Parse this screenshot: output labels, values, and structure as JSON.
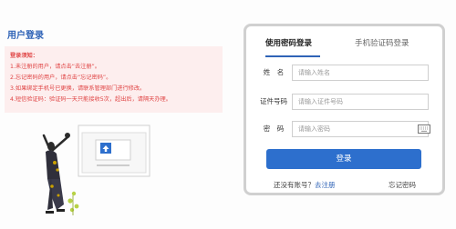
{
  "page": {
    "title": "用户登录"
  },
  "notice": {
    "title": "登录须知：",
    "lines": [
      "1.未注册的用户，请点击“去注册”。",
      "2.忘记密码的用户，请点击“忘记密码”。",
      "3.如果绑定手机号已更换，请联系管理部门进行修改。",
      "4.短信验证码：验证码一天只能接收5次，超出后，请隔天办理。"
    ]
  },
  "login": {
    "tabs": [
      "使用密码登录",
      "手机验证码登录"
    ],
    "fields": {
      "name": {
        "label": "姓　名",
        "placeholder": "请输入姓名"
      },
      "id": {
        "label": "证件号码",
        "placeholder": "请输入证件号码"
      },
      "password": {
        "label": "密　码",
        "placeholder": "请输入密码"
      }
    },
    "submit_label": "登录",
    "no_account_text": "还没有账号？",
    "register_link": "去注册",
    "forgot_link": "忘记密码"
  },
  "illustration": {
    "icon": "upload-arrow-icon"
  }
}
